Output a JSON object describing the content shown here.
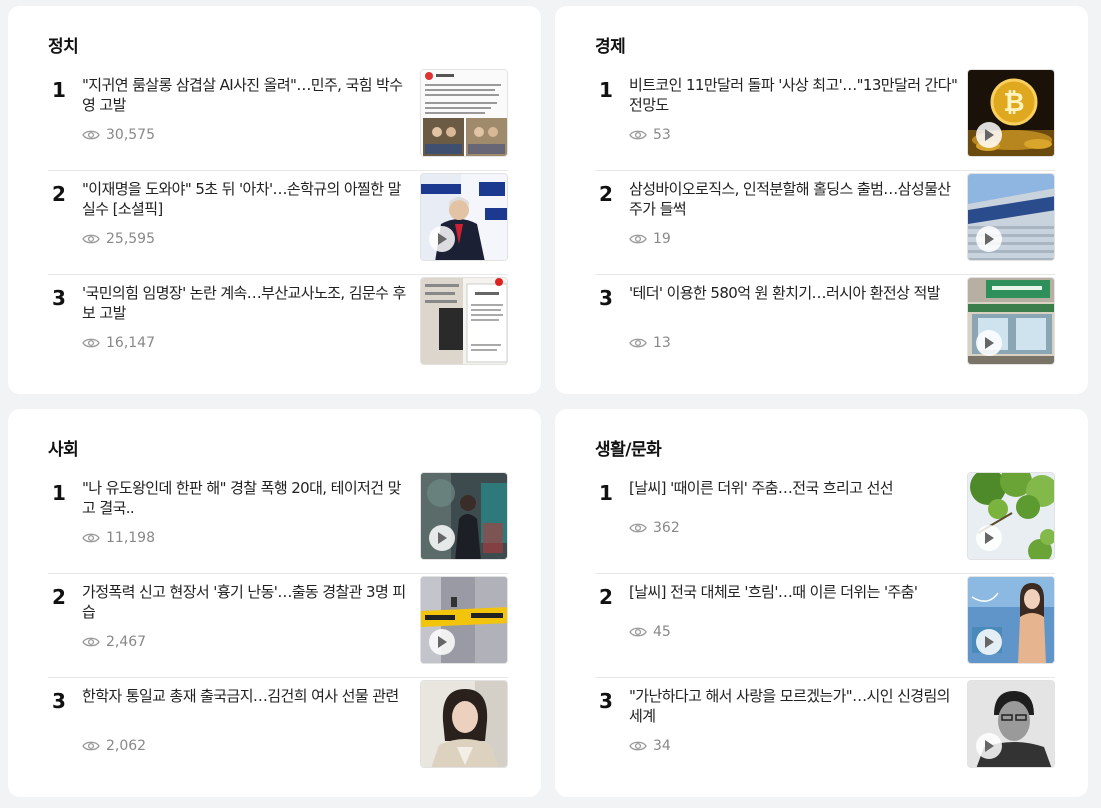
{
  "sections": [
    {
      "title": "정치",
      "items": [
        {
          "rank": "1",
          "headline": "\"지귀연 룸살롱 삼겹살 AI사진 올려\"…민주, 국힘 박수영 고발",
          "views": "30,575",
          "thumb_icon": "social-post-screenshot"
        },
        {
          "rank": "2",
          "headline": "\"이재명을 도와야\" 5초 뒤 '아차'…손학규의 아찔한 말실수 [소셜픽]",
          "views": "25,595",
          "thumb_icon": "speaker-at-podium"
        },
        {
          "rank": "3",
          "headline": "'국민의힘 임명장' 논란 계속…부산교사노조, 김문수 후보 고발",
          "views": "16,147",
          "thumb_icon": "appointment-letter-document"
        }
      ]
    },
    {
      "title": "경제",
      "items": [
        {
          "rank": "1",
          "headline": "비트코인 11만달러 돌파 '사상 최고'…\"13만달러 간다\" 전망도",
          "views": "53",
          "thumb_icon": "bitcoin-coins"
        },
        {
          "rank": "2",
          "headline": "삼성바이오로직스, 인적분할해 홀딩스 출범…삼성물산 주가 들썩",
          "views": "19",
          "thumb_icon": "samsung-building"
        },
        {
          "rank": "3",
          "headline": "'테더' 이용한 580억 원 환치기…러시아 환전상 적발",
          "views": "13",
          "thumb_icon": "storefront"
        }
      ]
    },
    {
      "title": "사회",
      "items": [
        {
          "rank": "1",
          "headline": "\"나 유도왕인데 한판 해\" 경찰 폭행 20대, 테이저건 맞고 결국..",
          "views": "11,198",
          "thumb_icon": "police-scene"
        },
        {
          "rank": "2",
          "headline": "가정폭력 신고 현장서 '흉기 난동'…출동 경찰관 3명 피습",
          "views": "2,467",
          "thumb_icon": "crime-scene-tape"
        },
        {
          "rank": "3",
          "headline": "한학자 통일교 총재 출국금지…김건희 여사 선물 관련",
          "views": "2,062",
          "thumb_icon": "woman-portrait"
        }
      ]
    },
    {
      "title": "생활/문화",
      "items": [
        {
          "rank": "1",
          "headline": "[날씨] '때이른 더위' 주춤…전국 흐리고 선선",
          "views": "362",
          "thumb_icon": "green-leaves"
        },
        {
          "rank": "2",
          "headline": "[날씨] 전국 대체로 '흐림'…때 이른 더위는 '주춤'",
          "views": "45",
          "thumb_icon": "weather-caster"
        },
        {
          "rank": "3",
          "headline": "\"가난하다고 해서 사랑을 모르겠는가\"…시인 신경림의 세계",
          "views": "34",
          "thumb_icon": "poet-portrait"
        }
      ]
    }
  ]
}
